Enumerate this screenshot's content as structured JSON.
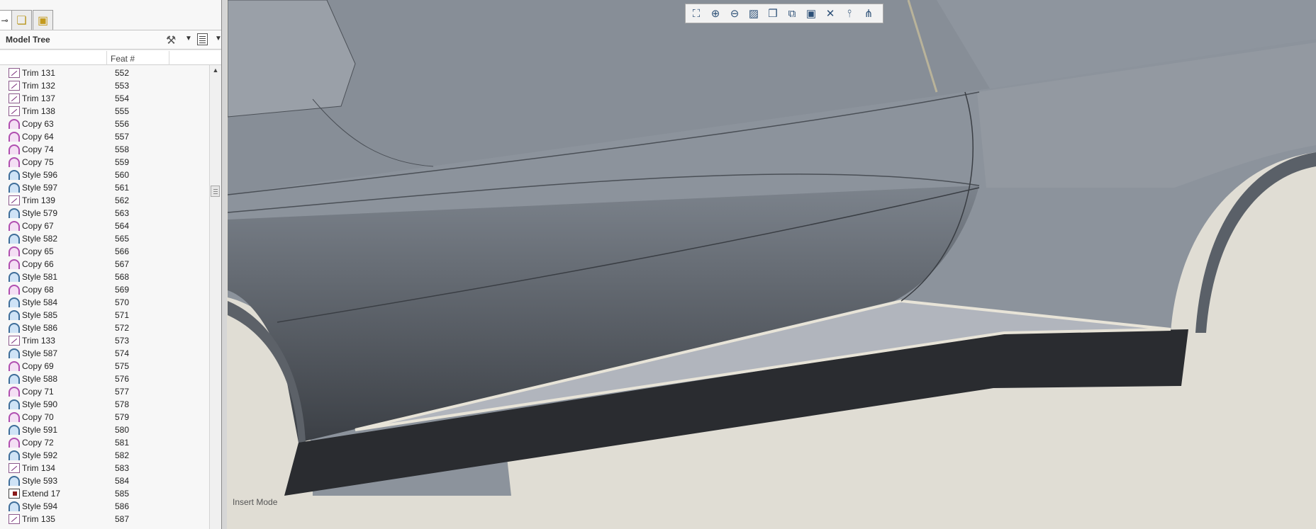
{
  "tabs": [
    "tree-icon",
    "layers-icon",
    "folder-camera-icon"
  ],
  "model_tree": {
    "title": "Model Tree",
    "column_feat": "Feat #",
    "rows": [
      {
        "icon": "trim",
        "name": "Trim 131",
        "feat": "552"
      },
      {
        "icon": "trim",
        "name": "Trim 132",
        "feat": "553"
      },
      {
        "icon": "trim",
        "name": "Trim 137",
        "feat": "554"
      },
      {
        "icon": "trim",
        "name": "Trim 138",
        "feat": "555"
      },
      {
        "icon": "copy",
        "name": "Copy 63",
        "feat": "556"
      },
      {
        "icon": "copy",
        "name": "Copy 64",
        "feat": "557"
      },
      {
        "icon": "copy",
        "name": "Copy 74",
        "feat": "558"
      },
      {
        "icon": "copy",
        "name": "Copy 75",
        "feat": "559"
      },
      {
        "icon": "style",
        "name": "Style 596",
        "feat": "560"
      },
      {
        "icon": "style",
        "name": "Style 597",
        "feat": "561"
      },
      {
        "icon": "trim",
        "name": "Trim 139",
        "feat": "562"
      },
      {
        "icon": "style",
        "name": "Style 579",
        "feat": "563"
      },
      {
        "icon": "copy",
        "name": "Copy 67",
        "feat": "564"
      },
      {
        "icon": "style",
        "name": "Style 582",
        "feat": "565"
      },
      {
        "icon": "copy",
        "name": "Copy 65",
        "feat": "566"
      },
      {
        "icon": "copy",
        "name": "Copy 66",
        "feat": "567"
      },
      {
        "icon": "style",
        "name": "Style 581",
        "feat": "568"
      },
      {
        "icon": "copy",
        "name": "Copy 68",
        "feat": "569"
      },
      {
        "icon": "style",
        "name": "Style 584",
        "feat": "570"
      },
      {
        "icon": "style",
        "name": "Style 585",
        "feat": "571"
      },
      {
        "icon": "style",
        "name": "Style 586",
        "feat": "572"
      },
      {
        "icon": "trim",
        "name": "Trim 133",
        "feat": "573"
      },
      {
        "icon": "style",
        "name": "Style 587",
        "feat": "574"
      },
      {
        "icon": "copy",
        "name": "Copy 69",
        "feat": "575"
      },
      {
        "icon": "style",
        "name": "Style 588",
        "feat": "576"
      },
      {
        "icon": "copy",
        "name": "Copy 71",
        "feat": "577"
      },
      {
        "icon": "style",
        "name": "Style 590",
        "feat": "578"
      },
      {
        "icon": "copy",
        "name": "Copy 70",
        "feat": "579"
      },
      {
        "icon": "style",
        "name": "Style 591",
        "feat": "580"
      },
      {
        "icon": "copy",
        "name": "Copy 72",
        "feat": "581"
      },
      {
        "icon": "style",
        "name": "Style 592",
        "feat": "582"
      },
      {
        "icon": "trim",
        "name": "Trim 134",
        "feat": "583"
      },
      {
        "icon": "style",
        "name": "Style 593",
        "feat": "584"
      },
      {
        "icon": "extend",
        "name": "Extend 17",
        "feat": "585"
      },
      {
        "icon": "style",
        "name": "Style 594",
        "feat": "586"
      },
      {
        "icon": "trim",
        "name": "Trim 135",
        "feat": "587"
      }
    ]
  },
  "view_toolbar": [
    "refit-icon",
    "zoom-in-icon",
    "zoom-out-icon",
    "repaint-icon",
    "display-style-icon",
    "saved-views-icon",
    "view-manager-icon",
    "datum-planes-icon",
    "datum-axes-icon",
    "datum-points-icon"
  ],
  "status": {
    "mode": "Insert Mode"
  },
  "colors": {
    "body_panel": "#8c939c",
    "viewport_bg": "#e0ddd4",
    "sill_dark": "#2a2c30",
    "sill_light": "#b1b5bd"
  }
}
